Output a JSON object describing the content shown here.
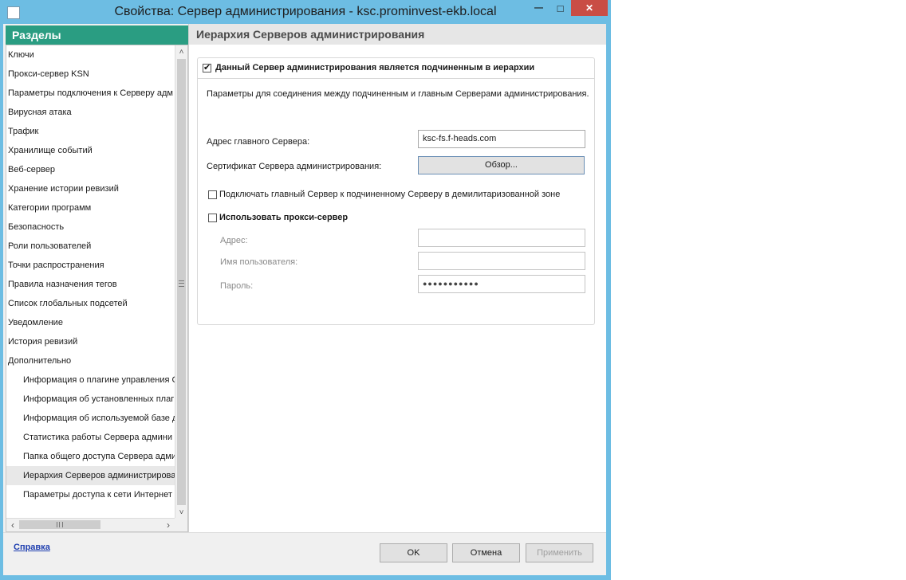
{
  "window": {
    "title": "Свойства: Сервер администрирования - ksc.prominvest-ekb.local",
    "controls": {
      "minimize": "—",
      "maximize": "□",
      "close": "✕"
    }
  },
  "sidebar": {
    "header": "Разделы",
    "items": [
      {
        "label": "Ключи",
        "level": 0,
        "selected": false
      },
      {
        "label": "Прокси-сервер KSN",
        "level": 0,
        "selected": false
      },
      {
        "label": "Параметры подключения к Серверу адм",
        "level": 0,
        "selected": false
      },
      {
        "label": "Вирусная атака",
        "level": 0,
        "selected": false
      },
      {
        "label": "Трафик",
        "level": 0,
        "selected": false
      },
      {
        "label": "Хранилище событий",
        "level": 0,
        "selected": false
      },
      {
        "label": "Веб-сервер",
        "level": 0,
        "selected": false
      },
      {
        "label": "Хранение истории ревизий",
        "level": 0,
        "selected": false
      },
      {
        "label": "Категории программ",
        "level": 0,
        "selected": false
      },
      {
        "label": "Безопасность",
        "level": 0,
        "selected": false
      },
      {
        "label": "Роли пользователей",
        "level": 0,
        "selected": false
      },
      {
        "label": "Точки распространения",
        "level": 0,
        "selected": false
      },
      {
        "label": "Правила назначения тегов",
        "level": 0,
        "selected": false
      },
      {
        "label": "Список глобальных подсетей",
        "level": 0,
        "selected": false
      },
      {
        "label": "Уведомление",
        "level": 0,
        "selected": false
      },
      {
        "label": "История ревизий",
        "level": 0,
        "selected": false
      },
      {
        "label": "Дополнительно",
        "level": 0,
        "selected": false
      },
      {
        "label": "Информация о плагине управления С",
        "level": 1,
        "selected": false
      },
      {
        "label": "Информация об установленных плаги",
        "level": 1,
        "selected": false
      },
      {
        "label": "Информация об используемой базе д",
        "level": 1,
        "selected": false
      },
      {
        "label": "Статистика работы Сервера админи",
        "level": 1,
        "selected": false
      },
      {
        "label": "Папка общего доступа Сервера адми",
        "level": 1,
        "selected": false
      },
      {
        "label": "Иерархия Серверов администрирова",
        "level": 1,
        "selected": true
      },
      {
        "label": "Параметры доступа к сети Интернет",
        "level": 1,
        "selected": false
      }
    ],
    "scroll_up": "˄",
    "scroll_down": "˅",
    "scroll_left": "‹",
    "scroll_right": "›"
  },
  "main": {
    "title": "Иерархия Серверов администрирования",
    "subordinate_checkbox": {
      "label": "Данный Сервер администрирования является подчиненным в иерархии",
      "checked": true
    },
    "description": "Параметры для соединения между подчиненным и главным Серверами администрирования.",
    "master_address_label": "Адрес главного Сервера:",
    "master_address_value": "ksc-fs.f-heads.com",
    "certificate_label": "Сертификат Сервера администрирования:",
    "browse_label": "Обзор...",
    "dmz_checkbox": {
      "label": "Подключать главный Сервер к подчиненному Серверу в демилитаризованной зоне",
      "checked": false
    },
    "proxy_checkbox": {
      "label": "Использовать прокси-сервер",
      "checked": false
    },
    "proxy_address_label": "Адрес:",
    "proxy_address_value": "",
    "proxy_user_label": "Имя пользователя:",
    "proxy_user_value": "",
    "proxy_password_label": "Пароль:",
    "proxy_password_value": "●●●●●●●●●●●"
  },
  "footer": {
    "help": "Справка",
    "ok": "OK",
    "cancel": "Отмена",
    "apply": "Применить"
  },
  "colors": {
    "title_bar": "#6dbde3",
    "sidebar_header": "#2a9d82",
    "close_button": "#c94d45",
    "link": "#1f3fb0"
  }
}
